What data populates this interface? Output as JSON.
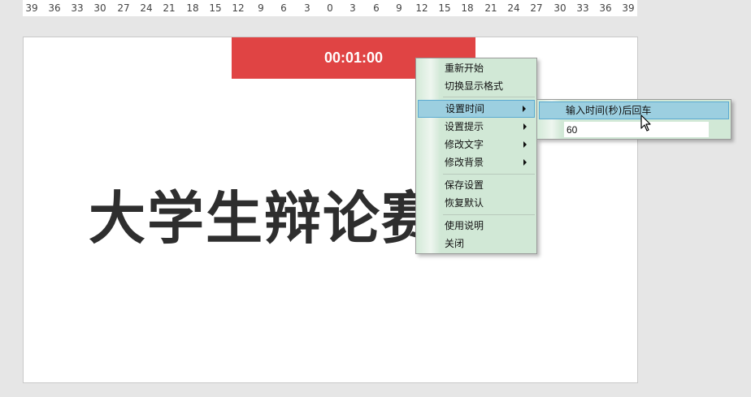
{
  "ruler": {
    "ticks": [
      "39",
      "36",
      "33",
      "30",
      "27",
      "24",
      "21",
      "18",
      "15",
      "12",
      "9",
      "6",
      "3",
      "0",
      "3",
      "6",
      "9",
      "12",
      "15",
      "18",
      "21",
      "24",
      "27",
      "30",
      "33",
      "36",
      "39"
    ]
  },
  "slide": {
    "timer": "00:01:00",
    "title": "大学生辩论赛"
  },
  "context_menu": {
    "items": [
      {
        "label": "重新开始"
      },
      {
        "label": "切换显示格式"
      },
      {
        "label": "设置时间"
      },
      {
        "label": "设置提示"
      },
      {
        "label": "修改文字"
      },
      {
        "label": "修改背景"
      },
      {
        "label": "保存设置"
      },
      {
        "label": "恢复默认"
      },
      {
        "label": "使用说明"
      },
      {
        "label": "关闭"
      }
    ],
    "active_index": 2
  },
  "submenu": {
    "label": "输入时间(秒)后回车",
    "input_value": "60"
  },
  "colors": {
    "timer_bg": "#e04444",
    "menu_bg": "#d1e8d6",
    "highlight": "#9ccfe0",
    "title_text": "#2e2e2e"
  }
}
